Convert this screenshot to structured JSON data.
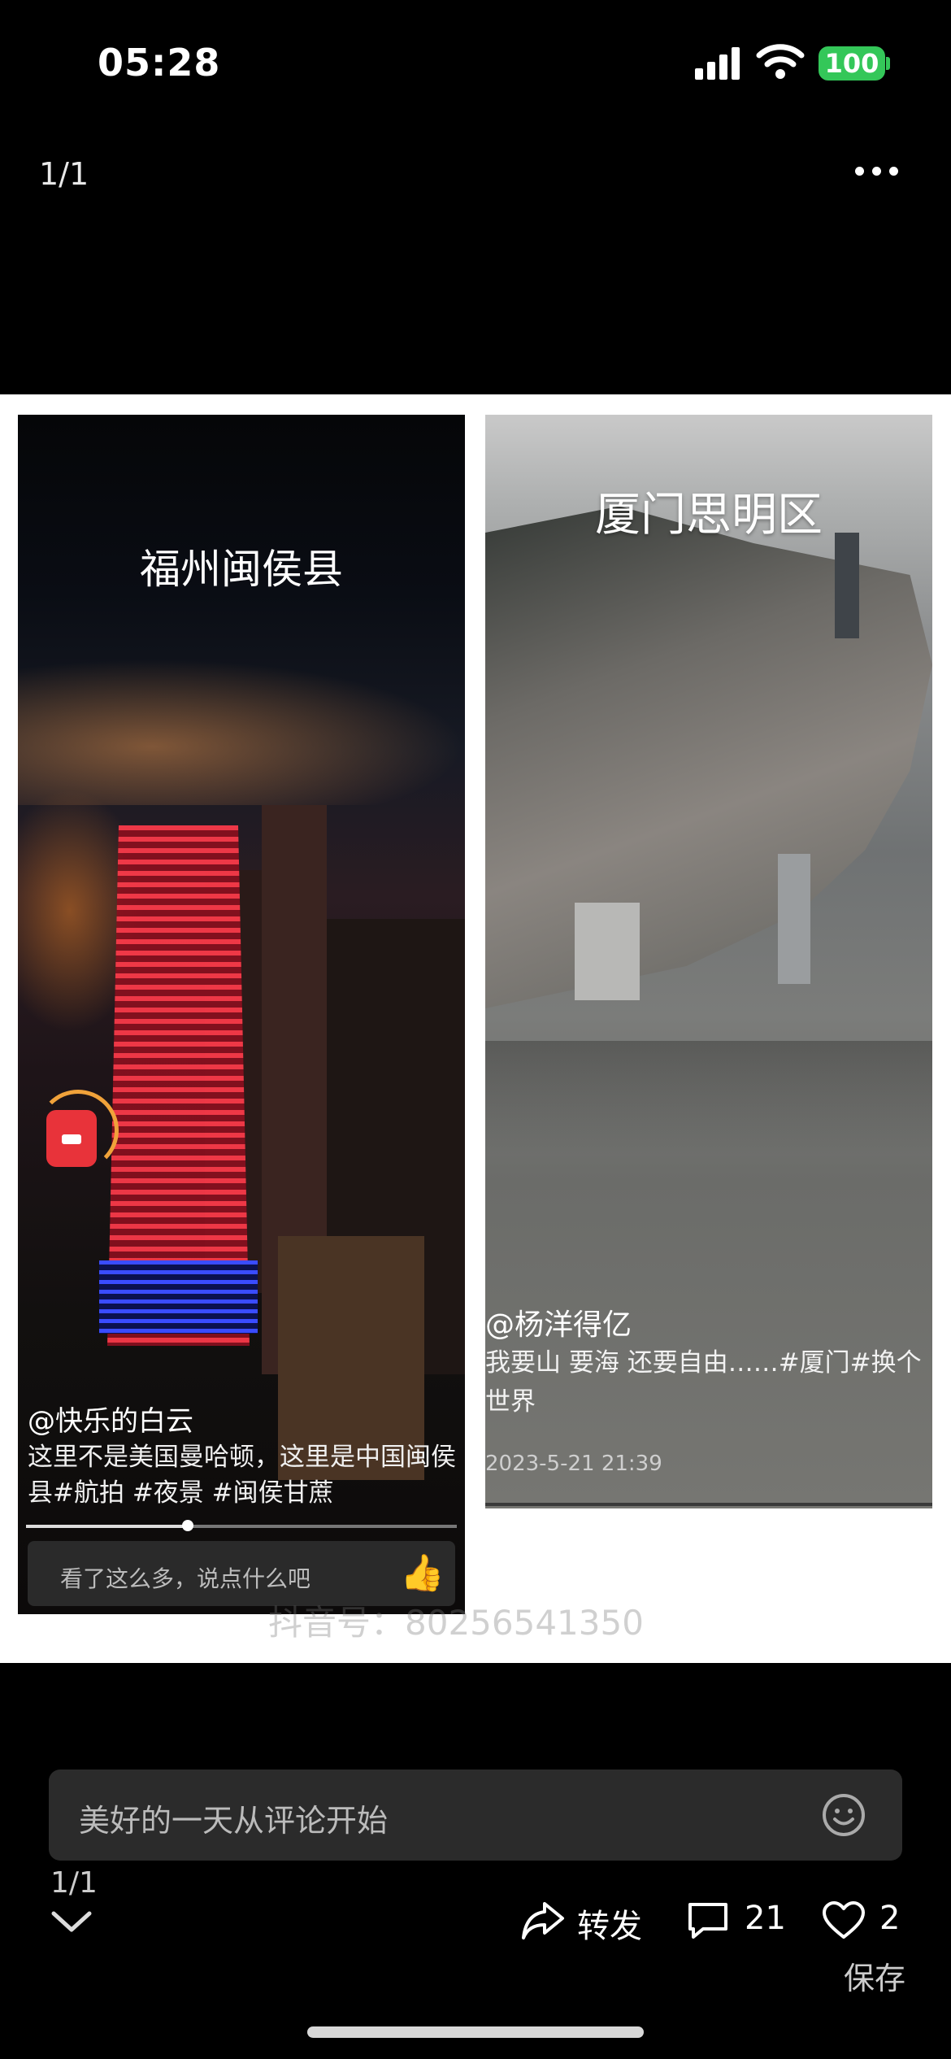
{
  "status_bar": {
    "time": "05:28",
    "battery": "100"
  },
  "header": {
    "page_indicator": "1/1"
  },
  "image": {
    "left_panel": {
      "title": "福州闽侯县",
      "username": "@快乐的白云",
      "description": "这里不是美国曼哈顿，这里是中国闽侯县#航拍 #夜景 #闽侯甘蔗",
      "comment_placeholder": "看了这么多，说点什么吧"
    },
    "right_panel": {
      "title": "厦门思明区",
      "username": "@杨洋得亿",
      "description_line1": "我要山 要海 还要自由……#厦门#换个",
      "description_line2": "世界",
      "date": "2023-5-21 21:39"
    },
    "watermark": "抖音号：80256541350"
  },
  "footer": {
    "comment_placeholder": "美好的一天从评论开始",
    "page_indicator": "1/1",
    "share_label": "转发",
    "comment_count": "21",
    "like_count": "2",
    "save_label": "保存"
  },
  "colors": {
    "battery": "#34c759",
    "background": "#000000",
    "input_bg": "#2b2b2b"
  }
}
